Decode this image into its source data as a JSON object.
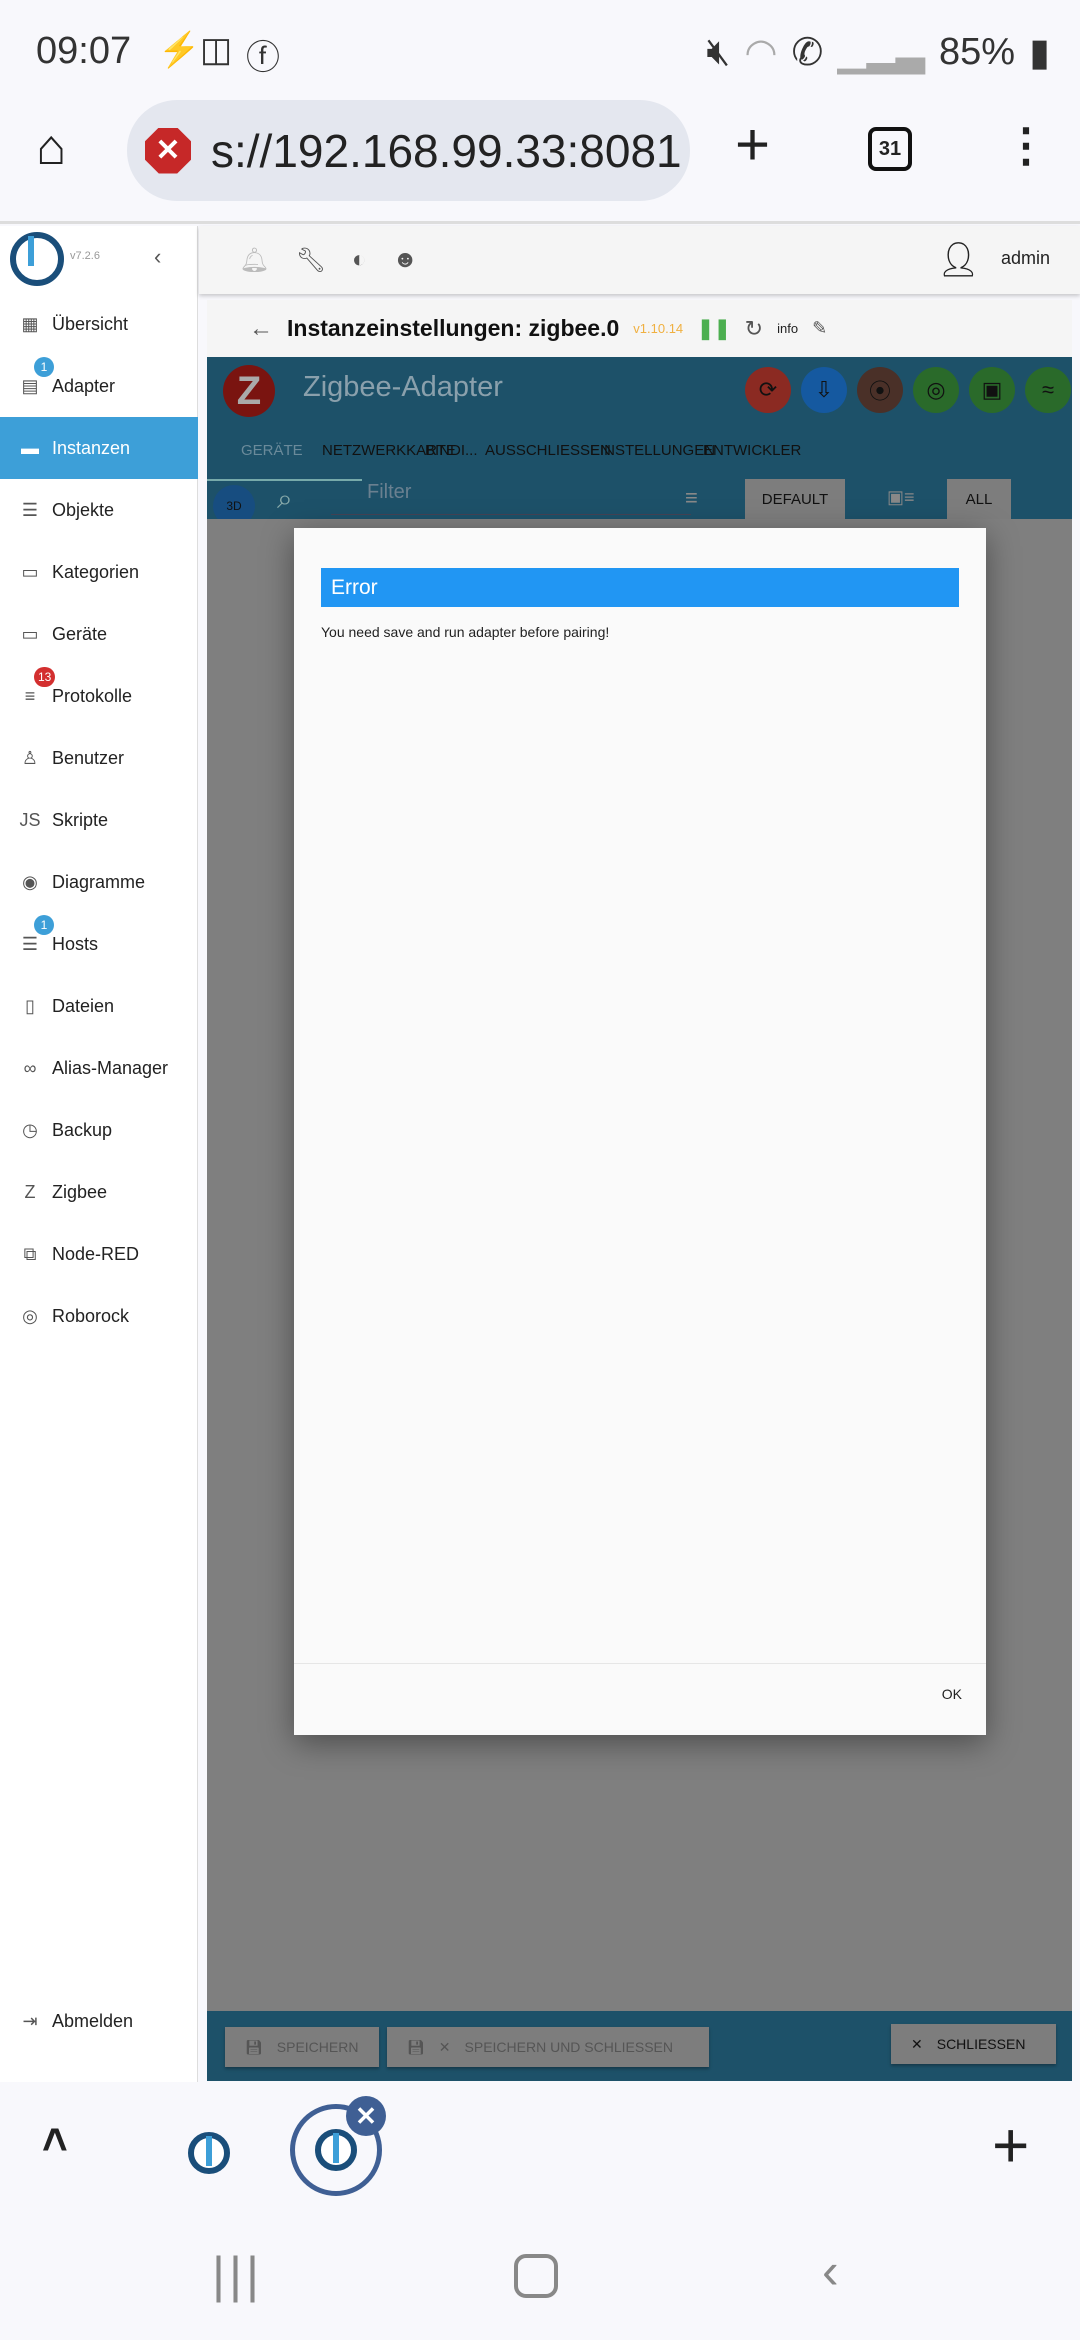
{
  "status": {
    "time": "09:07",
    "battery": "85%",
    "left_icons": [
      "bolt-icon",
      "instagram-icon",
      "facebook-icon"
    ],
    "right_icons": [
      "mute-icon",
      "wifi-icon",
      "wifi-call-icon",
      "signal-icon",
      "battery-icon"
    ]
  },
  "browser": {
    "url": "s://192.168.99.33:8081",
    "tab_count": "31"
  },
  "sidebar": {
    "version": "v7.2.6",
    "items": [
      {
        "label": "Übersicht",
        "icon": "▦"
      },
      {
        "label": "Adapter",
        "icon": "▤",
        "badge": "1",
        "badge_color": "#3d9fd8"
      },
      {
        "label": "Instanzen",
        "icon": "▬",
        "active": true
      },
      {
        "label": "Objekte",
        "icon": "☰"
      },
      {
        "label": "Kategorien",
        "icon": "▭"
      },
      {
        "label": "Geräte",
        "icon": "▭"
      },
      {
        "label": "Protokolle",
        "icon": "≡",
        "badge": "13",
        "badge_color": "#d32f2f"
      },
      {
        "label": "Benutzer",
        "icon": "♙"
      },
      {
        "label": "Skripte",
        "icon": "JS"
      },
      {
        "label": "Diagramme",
        "icon": "◉"
      },
      {
        "label": "Hosts",
        "icon": "☰",
        "badge": "1",
        "badge_color": "#3d9fd8"
      },
      {
        "label": "Dateien",
        "icon": "▯"
      },
      {
        "label": "Alias-Manager",
        "icon": "∞"
      },
      {
        "label": "Backup",
        "icon": "◷"
      },
      {
        "label": "Zigbee",
        "icon": "Z"
      },
      {
        "label": "Node-RED",
        "icon": "⧉"
      },
      {
        "label": "Roborock",
        "icon": "◎"
      }
    ],
    "logout": "Abmelden"
  },
  "appbar": {
    "user": "admin"
  },
  "instance": {
    "title": "Instanzeinstellungen: zigbee.0",
    "version": "v1.10.14",
    "info": "info"
  },
  "adapter": {
    "name": "Zigbee-Adapter",
    "tabs": [
      "GERÄTE",
      "NETZWERKKARTE",
      "BINDI...",
      "AUSSCHLIESSEN",
      "EINSTELLUNGEN",
      "ENTWICKLER"
    ],
    "filter_placeholder": "Filter",
    "default_button": "DEFAULT",
    "all_button": "ALL",
    "circle_colors": [
      "#8b2a22",
      "#1559a0",
      "#4a3028",
      "#2a6a2a",
      "#2a6a2a",
      "#2a6a2a"
    ]
  },
  "footer": {
    "save": "SPEICHERN",
    "save_close": "SPEICHERN UND SCHLIESSEN",
    "close": "SCHLIESSEN"
  },
  "dialog": {
    "title": "Error",
    "message": "You need save and run adapter before pairing!",
    "ok": "OK"
  }
}
